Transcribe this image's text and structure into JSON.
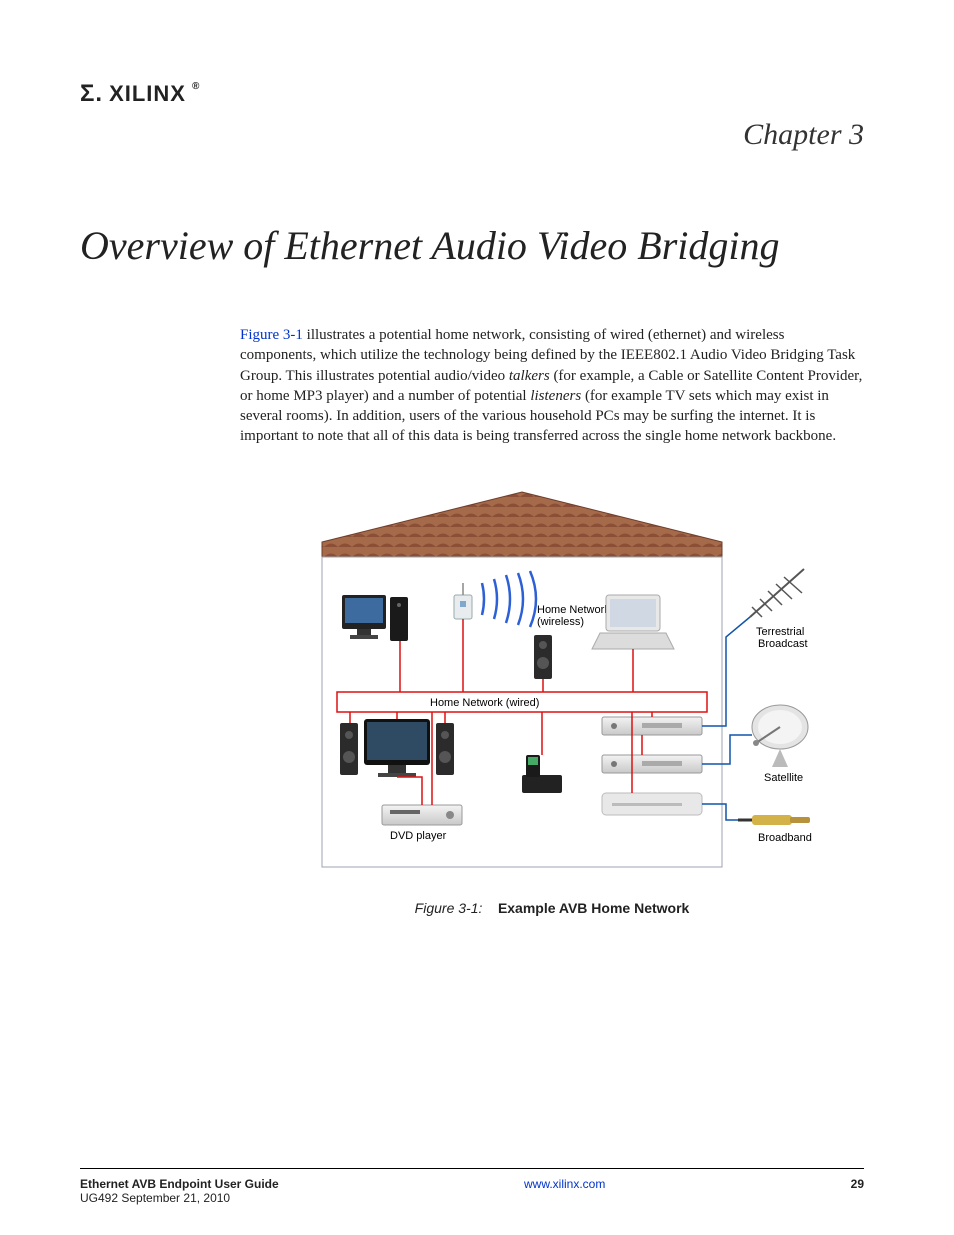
{
  "header": {
    "logo_text": "XILINX",
    "logo_reg": "®",
    "chapter_label": "Chapter 3"
  },
  "title": "Overview of Ethernet Audio Video Bridging",
  "paragraph": {
    "figref": "Figure 3-1",
    "text_after_ref": " illustrates a potential home network, consisting of wired (ethernet) and wireless components, which utilize the technology being defined by the IEEE802.1 Audio Video Bridging Task Group. This illustrates potential audio/video ",
    "italic1": "talkers",
    "text_mid": " (for example, a Cable or Satellite Content Provider, or home MP3 player) and a number of potential ",
    "italic2": "listeners",
    "text_tail": " (for example TV sets which may exist in several rooms). In addition, users of the various household PCs may be surfing the internet. It is important to note that all of this data is being transferred across the single home network backbone."
  },
  "diagram": {
    "labels": {
      "wireless": "Home Network (wireless)",
      "wired": "Home Network (wired)",
      "terrestrial1": "Terrestrial",
      "terrestrial2": "Broadcast",
      "satellite": "Satellite",
      "broadband": "Broadband",
      "dvd": "DVD player"
    },
    "caption_num": "Figure 3-1:",
    "caption_title": "Example AVB Home Network"
  },
  "footer": {
    "doc_title": "Ethernet AVB Endpoint User Guide",
    "doc_id": "UG492 September 21, 2010",
    "url": "www.xilinx.com",
    "page": "29"
  }
}
